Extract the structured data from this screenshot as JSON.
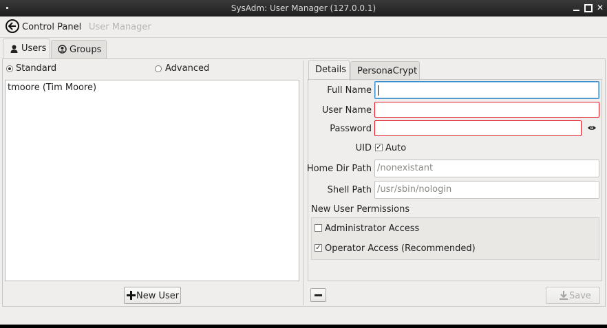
{
  "window": {
    "title": "SysAdm: User Manager (127.0.0.1)"
  },
  "nav": {
    "back_label": "Control Panel",
    "current": "User Manager"
  },
  "tabs": [
    {
      "label": "Users"
    },
    {
      "label": "Groups"
    }
  ],
  "left": {
    "modes": [
      {
        "label": "Standard",
        "selected": true
      },
      {
        "label": "Advanced",
        "selected": false
      }
    ],
    "users": [
      "tmoore (Tim Moore)"
    ],
    "new_user_label": "New User"
  },
  "right": {
    "tabs": [
      {
        "label": "Details"
      },
      {
        "label": "PersonaCrypt"
      }
    ],
    "fields": {
      "full_name": {
        "label": "Full Name",
        "value": ""
      },
      "user_name": {
        "label": "User Name",
        "value": ""
      },
      "password": {
        "label": "Password",
        "value": ""
      },
      "uid": {
        "label": "UID",
        "auto_label": "Auto",
        "auto_checked": true
      },
      "home_dir": {
        "label": "Home Dir Path",
        "placeholder": "/nonexistant"
      },
      "shell": {
        "label": "Shell Path",
        "placeholder": "/usr/sbin/nologin"
      }
    },
    "permissions": {
      "title": "New User Permissions",
      "items": [
        {
          "label": "Administrator Access",
          "checked": false
        },
        {
          "label": "Operator Access (Recommended)",
          "checked": true
        }
      ]
    },
    "save_label": "Save"
  },
  "colors": {
    "error_border": "#e0141c",
    "focus_border": "#3d8fcc"
  }
}
